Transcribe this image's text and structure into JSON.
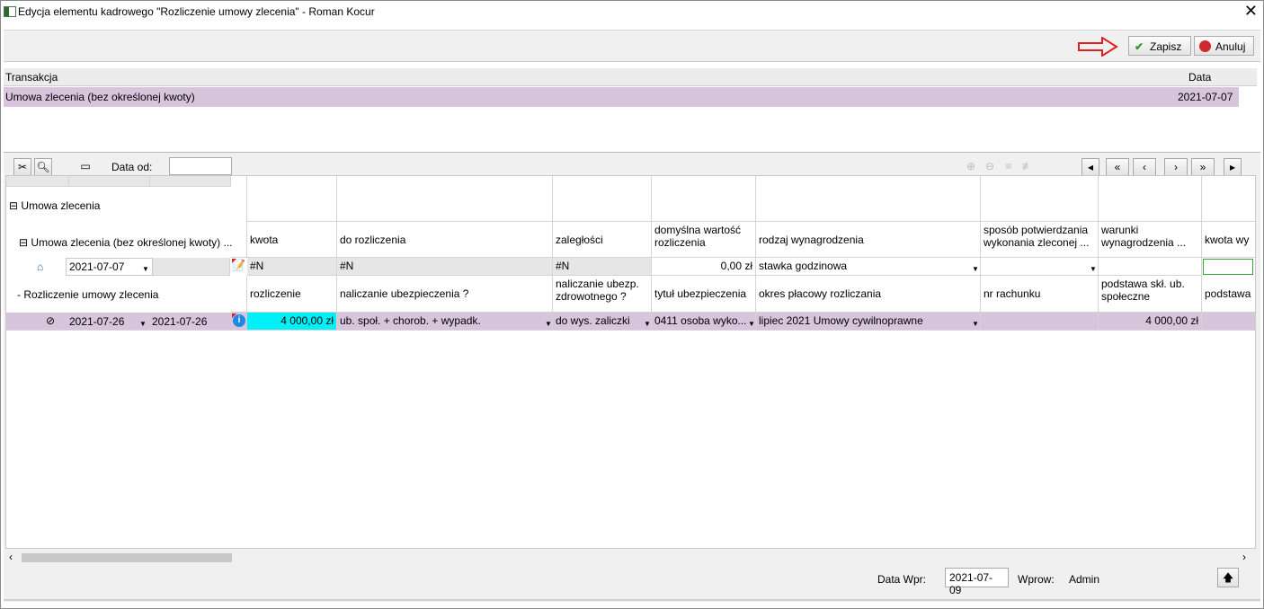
{
  "window": {
    "title": "Edycja elementu kadrowego \"Rozliczenie umowy zlecenia\" - Roman Kocur",
    "close_glyph": "✕"
  },
  "toolbar": {
    "save_label": "Zapisz",
    "cancel_label": "Anuluj",
    "colors": {
      "arrow": "#e02020",
      "save_check": "#2a9d2a",
      "cancel_icon": "#d02828"
    }
  },
  "transactions": {
    "headers": {
      "transaction": "Transakcja",
      "date": "Data"
    },
    "rows": [
      {
        "transaction": "Umowa zlecenia (bez określonej kwoty)",
        "date": "2021-07-07"
      }
    ]
  },
  "filter_bar": {
    "date_from_label": "Data od:",
    "date_from_value": "",
    "nav_buttons": [
      "◂",
      "«",
      "‹",
      "›",
      "»",
      "▸"
    ]
  },
  "tree": {
    "root": "Umowa zlecenia",
    "child": "Umowa zlecenia (bez określonej kwoty) ...",
    "row1": {
      "date": "2021-07-07"
    },
    "child2": "Rozliczenie umowy zlecenia",
    "row2": {
      "date_from": "2021-07-26",
      "date_to": "2021-07-26"
    }
  },
  "grid": {
    "header1": [
      "kwota",
      "do rozliczenia",
      "zaległości",
      "domyślna wartość rozliczenia",
      "rodzaj wynagrodzenia",
      "sposób potwierdzania wykonania zleconej ...",
      "warunki wynagrodzenia ...",
      "kwota wy"
    ],
    "row1": [
      "#N",
      "#N",
      "#N",
      "0,00 zł",
      "stawka godzinowa",
      "",
      "",
      ""
    ],
    "header2": [
      "rozliczenie",
      "naliczanie ubezpieczenia ?",
      "naliczanie ubezp. zdrowotnego ?",
      "tytuł ubezpieczenia",
      "okres płacowy rozliczania",
      "nr rachunku",
      "podstawa skł. ub. społeczne",
      "podstawa"
    ],
    "row2": [
      "4 000,00 zł",
      "ub. społ. + chorob. + wypadk.",
      "do wys. zaliczki",
      "0411 osoba wyko...",
      "lipiec 2021 Umowy cywilnoprawne",
      "",
      "4 000,00 zł",
      ""
    ],
    "colors": {
      "selected_row": "#d8c4dc",
      "active_cell": "#00f0f8",
      "new_cell_border": "#3aa33a"
    }
  },
  "status": {
    "date_label": "Data Wpr:",
    "date_value": "2021-07-09",
    "user_label": "Wprow:",
    "user_value": "Admin"
  }
}
